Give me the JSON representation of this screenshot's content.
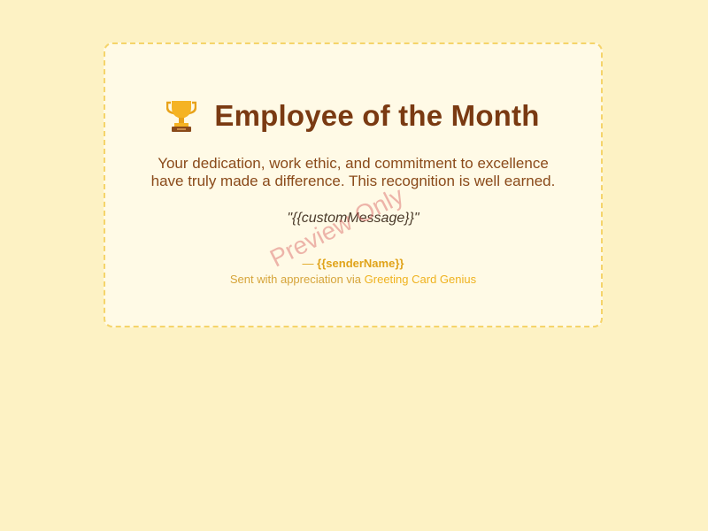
{
  "card": {
    "icon": "trophy-icon",
    "title": "Employee of the Month",
    "body_line_1": "Your dedication, work ethic, and commitment to excellence",
    "body_line_2": "have truly made a difference. This recognition is well earned.",
    "custom_message": "\"{{customMessage}}\"",
    "sender_prefix": "— ",
    "sender_name": "{{senderName}}",
    "credit_prefix": "Sent with appreciation via ",
    "credit_link": "Greeting Card Genius"
  },
  "watermark": {
    "text": "Preview Only"
  },
  "colors": {
    "page_background": "#fdf2c4",
    "card_background": "#fffae6",
    "card_border": "#f5d46a",
    "title": "#7a3a12",
    "accent": "#efb21f",
    "watermark": "#d75f5f"
  }
}
